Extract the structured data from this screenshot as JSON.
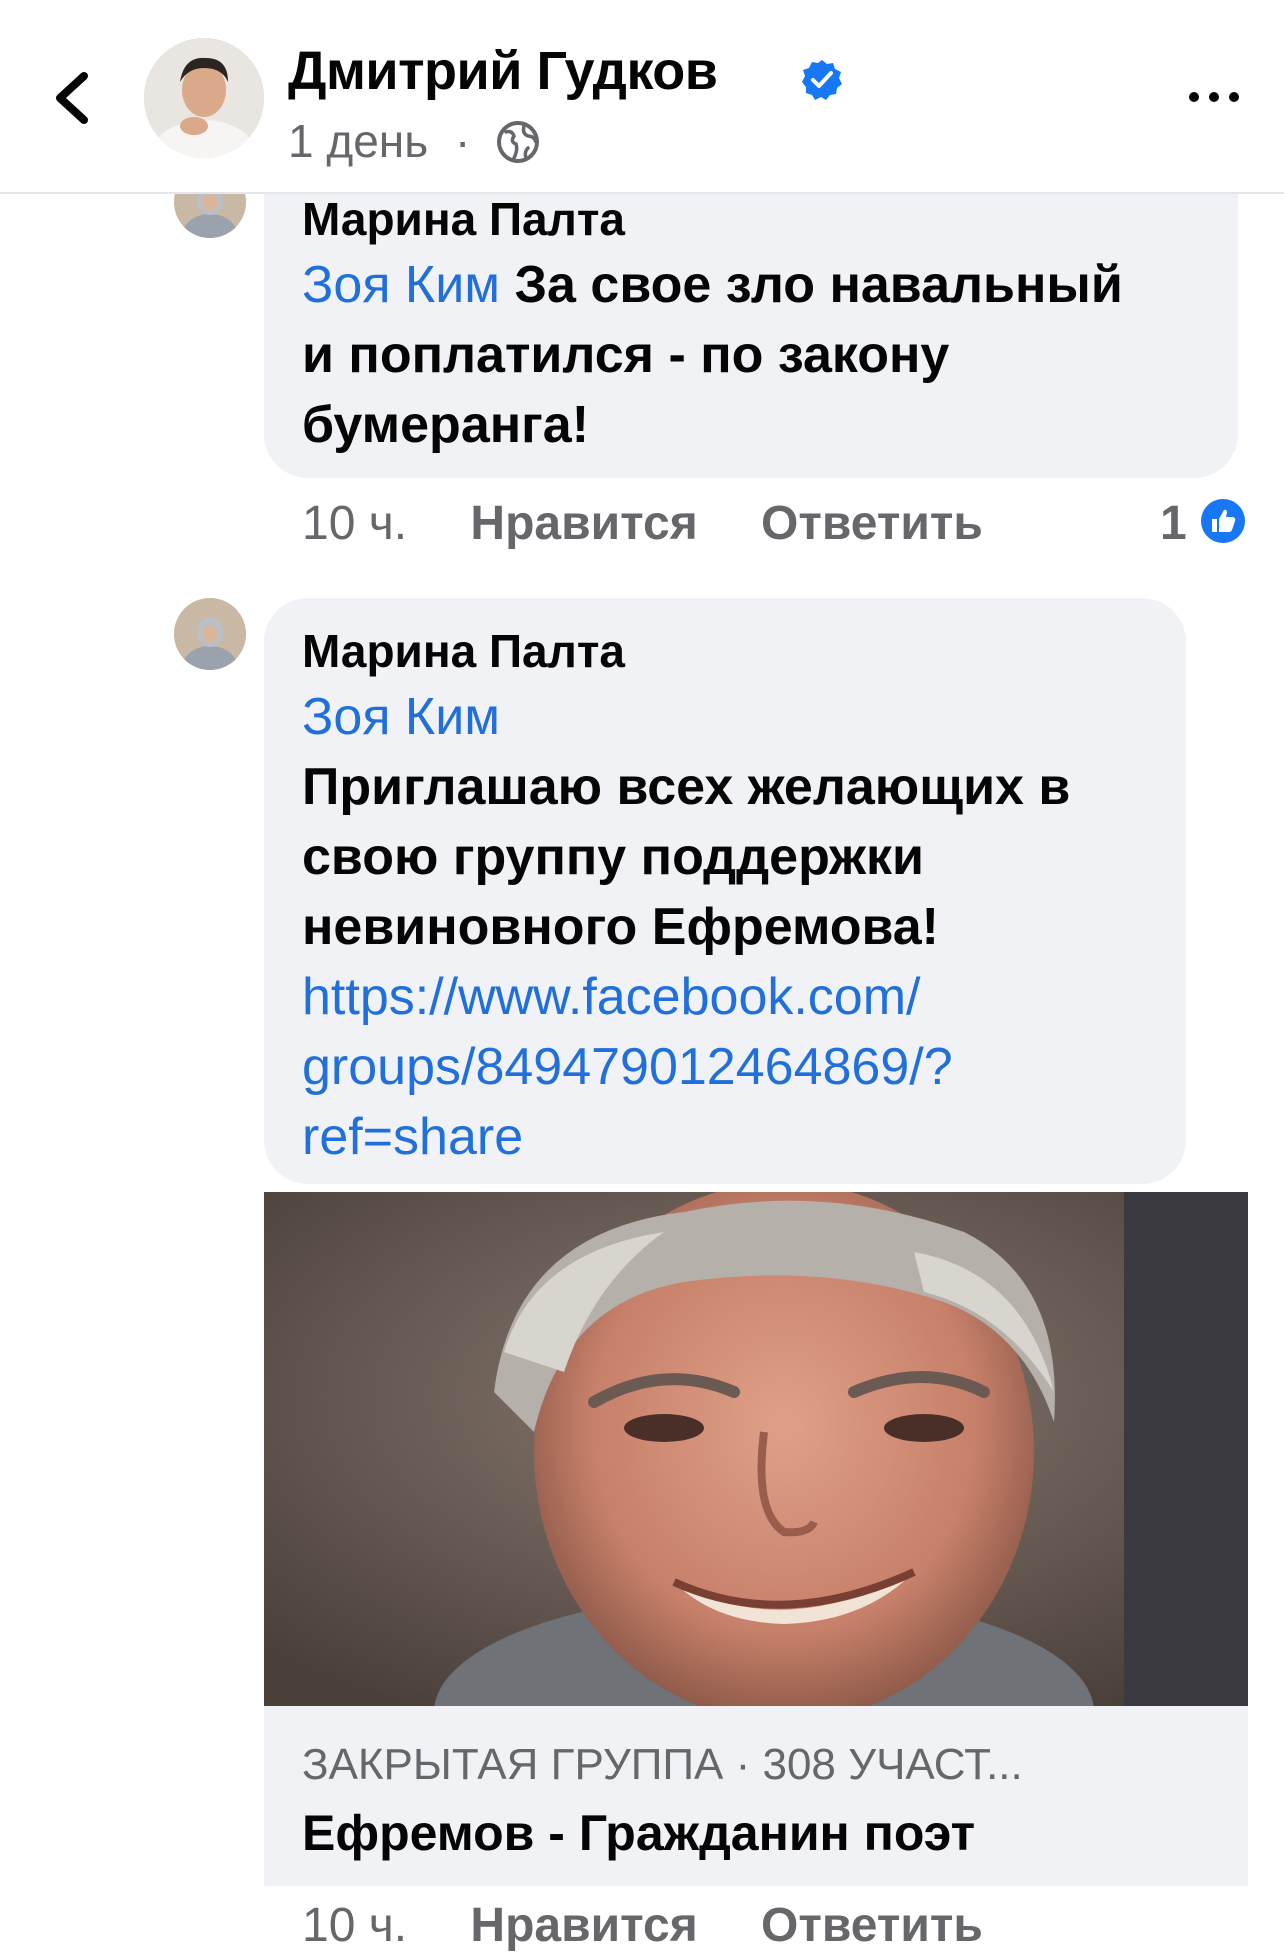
{
  "header": {
    "title": "Дмитрий Гудков",
    "time": "1 день",
    "separator": "·"
  },
  "comments": [
    {
      "author": "Марина Палта",
      "mention": "Зоя Ким",
      "text_lines": [
        "За свое зло навальный",
        "и поплатился - по закону",
        "бумеранга!"
      ],
      "time": "10 ч.",
      "like_label": "Нравится",
      "reply_label": "Ответить",
      "like_count": "1"
    },
    {
      "author": "Марина Палта",
      "mention": "Зоя Ким",
      "text_lines": [
        "Приглашаю всех желающих в",
        "свою группу поддержки",
        "невиновного Ефремова!"
      ],
      "link_lines": [
        "https://www.facebook.com/",
        "groups/849479012464869/?",
        "ref=share"
      ],
      "preview": {
        "meta": "ЗАКРЫТАЯ ГРУППА · 308 УЧАСТ...",
        "title": "Ефремов - Гражданин поэт"
      },
      "time": "10 ч.",
      "like_label": "Нравится",
      "reply_label": "Ответить"
    }
  ],
  "colors": {
    "accent": "#216fdb",
    "bubble": "#f0f2f5",
    "secondary_text": "#65676b",
    "verified": "#1877f2"
  },
  "icons": [
    "back-chevron-icon",
    "verified-badge-icon",
    "globe-icon",
    "more-dots-icon",
    "like-thumb-icon"
  ]
}
